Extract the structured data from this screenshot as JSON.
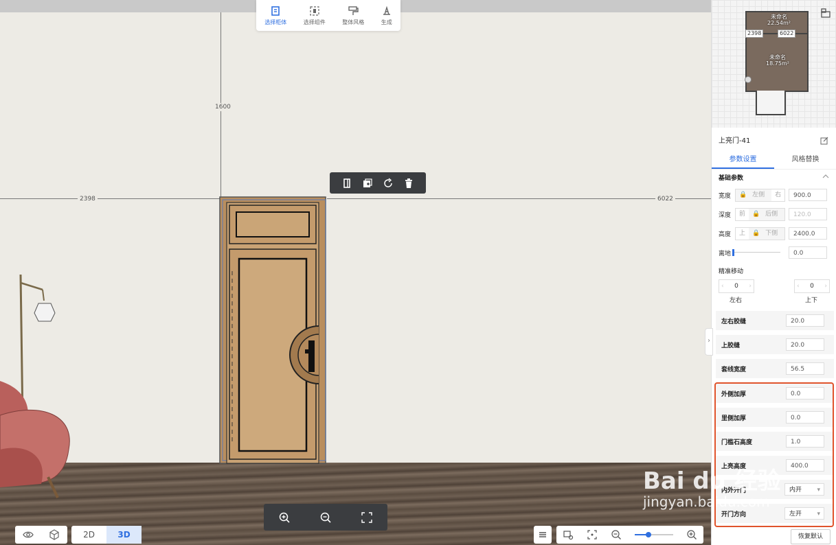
{
  "toolbar": {
    "buttons": [
      {
        "label": "选择柜体",
        "icon": "select-cabinet-icon",
        "active": true
      },
      {
        "label": "选择组件",
        "icon": "select-component-icon",
        "active": false
      },
      {
        "label": "整体风格",
        "icon": "paint-roller-icon",
        "active": false
      },
      {
        "label": "生成",
        "icon": "generate-icon",
        "active": false
      }
    ]
  },
  "dimensions": {
    "height": "1600",
    "left": "2398",
    "right": "6022"
  },
  "floating_toolbar": {
    "icons": [
      "door-icon",
      "add-copy-icon",
      "rotate-icon",
      "delete-icon"
    ]
  },
  "zoom_bar": {
    "icons": [
      "zoom-in-icon",
      "zoom-out-icon",
      "fit-screen-icon"
    ]
  },
  "view_toggle": {
    "options": [
      "2D",
      "3D"
    ],
    "active": "3D"
  },
  "bottom_right": {
    "icons": [
      "layers-icon",
      "camera-settings-icon",
      "focus-icon",
      "zoom-out-icon",
      "zoom-in-icon"
    ],
    "zoom_level": 0.35
  },
  "minimap": {
    "room1_label": "未命名",
    "room1_area": "22.54m²",
    "room2_label": "未命名",
    "room2_area": "18.75m²",
    "dim_left": "2398",
    "dim_right": "6022"
  },
  "panel": {
    "title": "上亮门-41",
    "tabs": [
      "参数设置",
      "风格替换"
    ],
    "active_tab": "参数设置",
    "section_basic": "基础参数",
    "width": {
      "label": "宽度",
      "opt_left": "左侧",
      "opt_right": "右",
      "value": "900.0"
    },
    "depth": {
      "label": "深度",
      "opt_front": "前",
      "opt_back": "后侧",
      "value": "120.0"
    },
    "height": {
      "label": "高度",
      "opt_top": "上",
      "opt_bottom": "下侧",
      "value": "2400.0"
    },
    "ground": {
      "label": "离地",
      "value": "0.0"
    },
    "precise_move": "精准移动",
    "move_lr": {
      "value": "0",
      "label": "左右"
    },
    "move_ud": {
      "value": "0",
      "label": "上下"
    },
    "fields": [
      {
        "label": "左右胶缝",
        "value": "20.0"
      },
      {
        "label": "上胶缝",
        "value": "20.0"
      },
      {
        "label": "套线宽度",
        "value": "56.5"
      },
      {
        "label": "外侧加厚",
        "value": "0.0"
      },
      {
        "label": "里侧加厚",
        "value": "0.0"
      },
      {
        "label": "门槛石高度",
        "value": "1.0"
      },
      {
        "label": "上亮高度",
        "value": "400.0"
      }
    ],
    "selects": [
      {
        "label": "内外开门",
        "value": "内开"
      },
      {
        "label": "开门方向",
        "value": "左开"
      }
    ],
    "restore_button": "恢复默认"
  },
  "watermark": {
    "brand": "Bai du 经验",
    "url": "jingyan.baidu.com"
  }
}
